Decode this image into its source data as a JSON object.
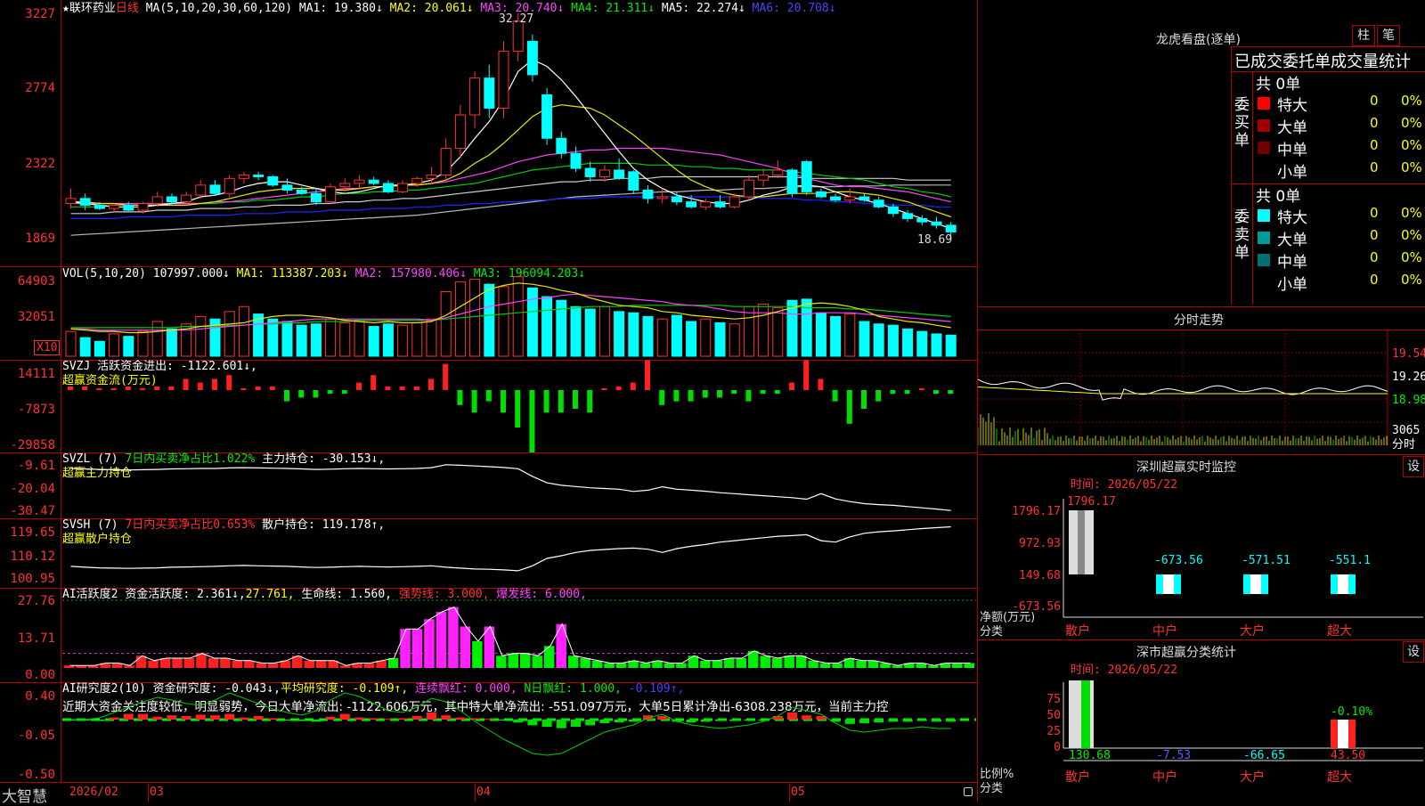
{
  "colors": {
    "up": "#ff3232",
    "down": "#00ffff",
    "ma1": "#ffffff",
    "ma2": "#e8e800",
    "ma3": "#ff44ff",
    "ma4": "#00cc00",
    "ma5": "#cccccc",
    "ma6": "#2222ff",
    "grid": "#b00000"
  },
  "kline": {
    "star": "★",
    "name": "联环药业",
    "period": "日线",
    "ma_label": "MA(5,10,20,30,60,120)",
    "ma1": "MA1: 19.380↓",
    "ma2": "MA2: 20.061↓",
    "ma3": "MA3: 20.740↓",
    "ma4": "MA4: 21.311↓",
    "ma5": "MA5: 22.274↓",
    "ma6": "MA6: 20.708↓",
    "y_ticks": [
      "3227",
      "2774",
      "2322",
      "1869"
    ],
    "high_label": "32.27",
    "low_label": "18.69",
    "candles": [
      [
        20.9,
        21.8,
        20.6,
        21.2
      ],
      [
        21.2,
        21.5,
        20.5,
        20.8
      ],
      [
        20.8,
        21.0,
        20.5,
        20.6
      ],
      [
        20.6,
        20.9,
        20.4,
        20.8
      ],
      [
        20.8,
        21.0,
        20.4,
        20.5
      ],
      [
        20.5,
        21.0,
        20.3,
        20.9
      ],
      [
        20.9,
        21.6,
        20.7,
        21.3
      ],
      [
        21.3,
        21.5,
        20.9,
        21.0
      ],
      [
        21.0,
        21.6,
        20.8,
        21.4
      ],
      [
        21.4,
        22.3,
        21.2,
        22.0
      ],
      [
        22.0,
        22.3,
        21.4,
        21.5
      ],
      [
        21.5,
        22.6,
        21.3,
        22.4
      ],
      [
        22.4,
        22.8,
        22.1,
        22.6
      ],
      [
        22.6,
        22.8,
        22.3,
        22.5
      ],
      [
        22.5,
        22.6,
        21.9,
        22.0
      ],
      [
        22.0,
        22.4,
        21.5,
        21.7
      ],
      [
        21.7,
        21.9,
        21.4,
        21.5
      ],
      [
        21.5,
        21.8,
        20.8,
        21.0
      ],
      [
        21.0,
        22.1,
        20.9,
        21.9
      ],
      [
        21.9,
        22.4,
        21.6,
        22.1
      ],
      [
        22.1,
        22.6,
        21.8,
        22.3
      ],
      [
        22.3,
        22.5,
        22.0,
        22.1
      ],
      [
        22.1,
        22.3,
        21.5,
        21.6
      ],
      [
        21.6,
        22.3,
        21.5,
        22.1
      ],
      [
        22.1,
        22.5,
        21.9,
        22.4
      ],
      [
        22.4,
        23.1,
        22.1,
        22.6
      ],
      [
        22.6,
        24.8,
        22.3,
        24.2
      ],
      [
        24.2,
        26.8,
        23.6,
        26.2
      ],
      [
        26.2,
        28.8,
        25.4,
        28.4
      ],
      [
        28.4,
        29.2,
        26.0,
        26.6
      ],
      [
        26.6,
        30.6,
        26.0,
        30.0
      ],
      [
        30.0,
        32.27,
        29.4,
        31.8
      ],
      [
        30.6,
        31.0,
        28.2,
        28.6
      ],
      [
        27.4,
        27.8,
        24.4,
        24.8
      ],
      [
        24.8,
        25.2,
        23.6,
        23.9
      ],
      [
        23.9,
        24.3,
        22.8,
        23.0
      ],
      [
        23.0,
        23.4,
        22.2,
        22.5
      ],
      [
        22.5,
        23.2,
        22.2,
        22.9
      ],
      [
        22.9,
        23.6,
        22.3,
        22.4
      ],
      [
        22.8,
        22.9,
        21.5,
        21.7
      ],
      [
        21.7,
        22.0,
        20.9,
        21.2
      ],
      [
        21.2,
        21.8,
        20.9,
        21.3
      ],
      [
        21.3,
        21.6,
        20.8,
        21.0
      ],
      [
        21.0,
        21.4,
        20.6,
        20.7
      ],
      [
        20.7,
        21.2,
        20.5,
        21.0
      ],
      [
        21.0,
        21.4,
        20.6,
        20.7
      ],
      [
        20.7,
        21.5,
        20.6,
        21.3
      ],
      [
        21.3,
        22.6,
        21.1,
        22.3
      ],
      [
        22.3,
        23.0,
        21.9,
        22.6
      ],
      [
        22.6,
        23.5,
        22.4,
        22.9
      ],
      [
        22.9,
        23.0,
        21.3,
        21.5
      ],
      [
        23.4,
        23.5,
        21.4,
        21.6
      ],
      [
        21.6,
        21.8,
        21.2,
        21.3
      ],
      [
        21.3,
        21.5,
        21.0,
        21.1
      ],
      [
        21.1,
        21.8,
        20.9,
        21.3
      ],
      [
        21.3,
        21.5,
        21.0,
        21.1
      ],
      [
        21.1,
        21.3,
        20.6,
        20.7
      ],
      [
        20.7,
        20.9,
        20.1,
        20.3
      ],
      [
        20.3,
        20.5,
        19.8,
        20.0
      ],
      [
        20.0,
        20.2,
        19.6,
        19.8
      ],
      [
        19.8,
        20.1,
        19.4,
        19.6
      ],
      [
        19.6,
        19.8,
        18.69,
        19.2
      ]
    ],
    "ma1_line": [
      21.0,
      20.9,
      20.8,
      20.7,
      20.7,
      20.7,
      20.8,
      20.9,
      21.0,
      21.3,
      21.4,
      21.6,
      21.9,
      22.1,
      22.2,
      22.2,
      22.0,
      21.8,
      21.6,
      21.5,
      21.6,
      21.8,
      22.0,
      22.0,
      22.1,
      22.3,
      22.8,
      23.7,
      24.8,
      25.8,
      27.1,
      28.8,
      29.5,
      29.1,
      28.3,
      27.3,
      26.2,
      25.1,
      24.0,
      23.0,
      22.3,
      21.8,
      21.4,
      21.2,
      21.0,
      20.9,
      20.9,
      21.1,
      21.4,
      21.6,
      21.9,
      22.0,
      21.9,
      21.6,
      21.3,
      21.1,
      20.9,
      20.6,
      20.3,
      20.0,
      19.7,
      19.4
    ],
    "ma2_line": [
      21.0,
      21.0,
      20.9,
      20.9,
      20.8,
      20.8,
      20.8,
      20.8,
      20.8,
      20.9,
      21.0,
      21.2,
      21.4,
      21.6,
      21.7,
      21.8,
      21.8,
      21.8,
      21.7,
      21.7,
      21.8,
      21.9,
      21.9,
      22.0,
      22.0,
      22.1,
      22.3,
      22.7,
      23.3,
      23.8,
      24.5,
      25.3,
      26.1,
      26.6,
      26.8,
      26.7,
      26.6,
      26.2,
      25.6,
      25.0,
      24.3,
      23.6,
      22.9,
      22.3,
      21.9,
      21.6,
      21.4,
      21.3,
      21.3,
      21.4,
      21.5,
      21.5,
      21.5,
      21.6,
      21.6,
      21.5,
      21.4,
      21.2,
      21.0,
      20.7,
      20.4,
      20.1
    ],
    "ma3_line": [
      20.9,
      20.9,
      20.9,
      20.9,
      20.9,
      20.9,
      20.9,
      20.9,
      20.9,
      20.9,
      21.0,
      21.0,
      21.1,
      21.2,
      21.3,
      21.4,
      21.5,
      21.6,
      21.7,
      21.8,
      21.8,
      21.9,
      21.9,
      22.0,
      22.0,
      22.1,
      22.2,
      22.4,
      22.6,
      22.8,
      23.1,
      23.4,
      23.6,
      23.8,
      23.9,
      24.0,
      24.1,
      24.1,
      24.2,
      24.2,
      24.2,
      24.2,
      24.1,
      24.0,
      23.9,
      23.8,
      23.6,
      23.4,
      23.2,
      23.0,
      22.7,
      22.4,
      22.2,
      22.0,
      21.9,
      21.9,
      21.8,
      21.7,
      21.6,
      21.4,
      21.2,
      21.0
    ],
    "ma4_line": [
      20.7,
      20.7,
      20.7,
      20.8,
      20.8,
      20.8,
      20.8,
      20.9,
      20.9,
      20.9,
      20.9,
      21.0,
      21.0,
      21.1,
      21.1,
      21.2,
      21.3,
      21.3,
      21.4,
      21.5,
      21.5,
      21.6,
      21.6,
      21.7,
      21.7,
      21.8,
      21.9,
      22.0,
      22.1,
      22.3,
      22.5,
      22.7,
      22.9,
      23.0,
      23.1,
      23.2,
      23.3,
      23.3,
      23.3,
      23.3,
      23.2,
      23.2,
      23.2,
      23.1,
      23.1,
      23.0,
      23.0,
      22.9,
      22.9,
      22.9,
      22.8,
      22.7,
      22.6,
      22.5,
      22.4,
      22.3,
      22.1,
      21.9,
      21.8,
      21.6,
      21.5,
      21.3
    ],
    "ma5_line": [
      20.3,
      20.3,
      20.3,
      20.4,
      20.4,
      20.4,
      20.5,
      20.5,
      20.5,
      20.6,
      20.6,
      20.6,
      20.7,
      20.7,
      20.8,
      20.8,
      20.8,
      20.9,
      20.9,
      21.0,
      21.0,
      21.1,
      21.1,
      21.2,
      21.2,
      21.3,
      21.4,
      21.5,
      21.6,
      21.7,
      21.8,
      21.9,
      22.0,
      22.1,
      22.2,
      22.2,
      22.3,
      22.3,
      22.4,
      22.4,
      22.4,
      22.5,
      22.5,
      22.5,
      22.5,
      22.5,
      22.5,
      22.5,
      22.5,
      22.5,
      22.5,
      22.4,
      22.4,
      22.4,
      22.4,
      22.4,
      22.4,
      22.4,
      22.3,
      22.3,
      22.3,
      22.3
    ],
    "ma6_line": [
      20.0,
      20.0,
      20.0,
      20.0,
      20.1,
      20.1,
      20.1,
      20.1,
      20.2,
      20.2,
      20.2,
      20.2,
      20.3,
      20.3,
      20.3,
      20.4,
      20.4,
      20.4,
      20.5,
      20.5,
      20.5,
      20.6,
      20.6,
      20.6,
      20.7,
      20.7,
      20.8,
      20.8,
      20.9,
      20.9,
      21.0,
      21.0,
      21.1,
      21.1,
      21.2,
      21.2,
      21.2,
      21.3,
      21.3,
      21.3,
      21.3,
      21.3,
      21.3,
      21.3,
      21.3,
      21.3,
      21.3,
      21.3,
      21.2,
      21.2,
      21.2,
      21.1,
      21.1,
      21.0,
      21.0,
      20.9,
      20.9,
      20.8,
      20.8,
      20.8,
      20.7,
      20.7
    ],
    "base_line": [
      19.0,
      19.05,
      19.1,
      19.15,
      19.2,
      19.25,
      19.3,
      19.35,
      19.4,
      19.45,
      19.5,
      19.55,
      19.6,
      19.65,
      19.7,
      19.75,
      19.8,
      19.85,
      19.9,
      19.95,
      20.0,
      20.05,
      20.1,
      20.15,
      20.2,
      20.3,
      20.4,
      20.5,
      20.6,
      20.7,
      20.8,
      20.9,
      21.0,
      21.1,
      21.2,
      21.3,
      21.35,
      21.4,
      21.45,
      21.5,
      21.55,
      21.6,
      21.6,
      21.65,
      21.7,
      21.7,
      21.75,
      21.8,
      21.8,
      21.85,
      21.9,
      21.9,
      21.9,
      21.9,
      21.95,
      21.95,
      21.95,
      22.0,
      22.0,
      22.0,
      22.0,
      22.0
    ]
  },
  "vol": {
    "label": "VOL(5,10,20)",
    "v": "107997.000↓",
    "ma1": "MA1: 113387.203↓",
    "ma2": "MA2: 157980.406↓",
    "ma3": "MA3: 196094.203↓",
    "y_ticks": [
      "64903",
      "32051"
    ],
    "unit": "X10",
    "values": [
      20,
      15,
      12,
      18,
      16,
      20,
      28,
      22,
      26,
      32,
      30,
      36,
      40,
      34,
      30,
      28,
      25,
      26,
      30,
      27,
      29,
      24,
      26,
      25,
      27,
      30,
      52,
      60,
      62,
      58,
      56,
      64,
      55,
      48,
      45,
      40,
      38,
      40,
      36,
      35,
      32,
      30,
      33,
      28,
      30,
      27,
      26,
      40,
      42,
      39,
      45,
      46,
      35,
      32,
      34,
      28,
      26,
      25,
      22,
      20,
      18,
      17
    ],
    "ma1_line": [
      22,
      21,
      20,
      20,
      19,
      19,
      20,
      21,
      22,
      24,
      25,
      26,
      27,
      30,
      32,
      33,
      33,
      32,
      31,
      29,
      28,
      27,
      28,
      27,
      27,
      28,
      33,
      40,
      47,
      54,
      57,
      59,
      58,
      56,
      53,
      51,
      47,
      44,
      41,
      40,
      39,
      36,
      35,
      33,
      32,
      31,
      30,
      31,
      33,
      36,
      39,
      42,
      43,
      42,
      40,
      37,
      32,
      30,
      28,
      27,
      25,
      23
    ],
    "ma2_line": [
      22,
      22,
      21,
      21,
      21,
      21,
      21,
      21,
      21,
      22,
      23,
      24,
      25,
      26,
      27,
      28,
      29,
      30,
      30,
      30,
      30,
      30,
      30,
      30,
      30,
      29,
      31,
      34,
      37,
      40,
      42,
      44,
      46,
      47,
      49,
      50,
      49,
      48,
      47,
      46,
      45,
      44,
      42,
      41,
      40,
      38,
      36,
      35,
      35,
      35,
      34,
      34,
      35,
      35,
      35,
      34,
      33,
      32,
      31,
      30,
      29,
      28
    ],
    "ma3_line": [
      23,
      23,
      23,
      23,
      23,
      23,
      23,
      23,
      24,
      24,
      24,
      25,
      25,
      26,
      26,
      27,
      27,
      28,
      28,
      28,
      29,
      29,
      29,
      29,
      29,
      29,
      30,
      31,
      32,
      33,
      34,
      35,
      36,
      37,
      38,
      39,
      40,
      40,
      40,
      41,
      41,
      41,
      41,
      41,
      41,
      41,
      40,
      40,
      40,
      40,
      40,
      39,
      39,
      39,
      38,
      38,
      37,
      36,
      35,
      34,
      33,
      32
    ]
  },
  "svzj": {
    "label": "SVZJ",
    "active": "活跃资金进出: -1122.601↓,",
    "sub": "超赢资金流(万元)",
    "y_ticks": [
      "14111",
      "-7873",
      "-29858"
    ],
    "values": [
      1,
      1,
      0.5,
      0.5,
      1,
      0.5,
      1,
      1,
      3,
      2,
      3,
      4,
      0.5,
      1,
      1,
      -3,
      -2,
      -2,
      -1,
      -1,
      2,
      4,
      1,
      1,
      1,
      3,
      7,
      -4,
      -6,
      -3,
      -6,
      -10,
      -19,
      -6,
      -6,
      -5,
      -6,
      0.5,
      1,
      2,
      8,
      -4,
      -3,
      -3,
      -2,
      -2,
      -1,
      -3,
      -1,
      -1,
      2,
      8,
      3,
      -3,
      -9,
      -5,
      -3,
      -1,
      -1,
      0.5,
      -1,
      -1
    ]
  },
  "svzl": {
    "label": "SVZL (7)",
    "ratio": "7日内买卖净占比1.022%",
    "hold": "主力持仓: -30.153↓,",
    "sub": "超赢主力持仓",
    "y_ticks": [
      "-9.61",
      "-20.04",
      "-30.47"
    ],
    "line": [
      -13.2,
      -13.4,
      -13.6,
      -13.7,
      -13.8,
      -13.7,
      -13.6,
      -13.4,
      -13.3,
      -13.2,
      -13.2,
      -13.0,
      -12.9,
      -13.0,
      -13.1,
      -13.2,
      -13.4,
      -13.6,
      -13.5,
      -13.3,
      -13.2,
      -13.3,
      -13.4,
      -13.3,
      -13.2,
      -12.9,
      -11.7,
      -11.9,
      -12.2,
      -12.5,
      -12.8,
      -13.3,
      -16.4,
      -19.0,
      -20.0,
      -20.5,
      -21.0,
      -21.3,
      -21.6,
      -22.5,
      -22.0,
      -20.6,
      -21.6,
      -22.0,
      -22.4,
      -23.0,
      -23.4,
      -23.8,
      -24.2,
      -24.6,
      -25.0,
      -25.6,
      -23.4,
      -25.5,
      -26.6,
      -27.4,
      -27.8,
      -28.1,
      -28.6,
      -29.1,
      -29.6,
      -30.2
    ]
  },
  "svsh": {
    "label": "SVSH (7)",
    "ratio": "7日内买卖净占比0.653%",
    "hold": "散户持仓: 119.178↑,",
    "sub": "超赢散户持仓",
    "y_ticks": [
      "119.65",
      "110.12",
      "100.95"
    ],
    "line": [
      105.8,
      105.5,
      105.3,
      105.2,
      105.1,
      105.2,
      105.3,
      105.5,
      105.6,
      105.7,
      105.8,
      106.0,
      106.1,
      106.0,
      105.9,
      105.8,
      105.6,
      105.4,
      105.5,
      105.7,
      105.8,
      105.7,
      105.6,
      105.7,
      105.8,
      106.0,
      105.5,
      105.2,
      104.9,
      104.8,
      104.6,
      104.3,
      106.0,
      108.5,
      109.4,
      110.5,
      111.2,
      111.5,
      111.8,
      112.0,
      111.6,
      110.5,
      111.8,
      112.6,
      113.2,
      114.0,
      114.5,
      115.0,
      115.5,
      116.0,
      116.2,
      116.5,
      114.5,
      114.0,
      115.8,
      117.0,
      117.5,
      117.8,
      118.2,
      118.6,
      118.9,
      119.2
    ]
  },
  "ai1": {
    "label": "AI活跃度2",
    "activity": "资金活跃度: 2.361↓,",
    "v2": "27.761,",
    "life": "生命线: 1.560,",
    "strong": "强势线: 3.000,",
    "burst": "爆发线: 6.000,",
    "y_ticks": [
      "27.76",
      "13.71",
      "0.00"
    ],
    "values": [
      1,
      1,
      1,
      2,
      2,
      1,
      5,
      3,
      4,
      4,
      4,
      6,
      4,
      4,
      3,
      3,
      2,
      2,
      3,
      5,
      3,
      3,
      3,
      1,
      2,
      2,
      3,
      4,
      16,
      16,
      20,
      23,
      25,
      17,
      11,
      17,
      5,
      6,
      6,
      5,
      9,
      18,
      5,
      4,
      3,
      2,
      2,
      3,
      2,
      3,
      2,
      2,
      5,
      3,
      3,
      4,
      4,
      7,
      5,
      4,
      5,
      5,
      3,
      2,
      2,
      4,
      3,
      3,
      2,
      1,
      2,
      2,
      1,
      2,
      2,
      2
    ]
  },
  "ai2": {
    "label": "AI研究度2(10)",
    "research": "资金研究度: -0.043↓,",
    "avg": "平均研究度: -0.109↑,",
    "streak": "连续飘红: 0.000,",
    "n_red": "N日飘红: 1.000,",
    "v": "-0.109↑,",
    "y_ticks": [
      "0.40",
      "-0.05",
      "-0.50"
    ],
    "comment": "近期大资金关注度较低，明显弱势，今日大单净流出: -1122.606万元，其中特大单净流出: -551.097万元，大单5日累计净出-6308.238万元，当前主力控"
  },
  "bottom": {
    "logo": "大智慧",
    "dates": [
      "2026/02",
      "03",
      "04",
      "05"
    ]
  },
  "dragon": {
    "title": "龙虎看盘(逐单)",
    "btn1": "柱",
    "btn2": "笔",
    "tabs_label": "已成交委托单成交量统计",
    "buy_label": "委买单",
    "sell_label": "委卖单",
    "total_buy": "共 0单",
    "total_sell": "共 0单",
    "buy_rows": [
      {
        "label": "特大",
        "count": "0",
        "pct": "0%",
        "color": "#ff0000"
      },
      {
        "label": "大单",
        "count": "0",
        "pct": "0%",
        "color": "#a00000"
      },
      {
        "label": "中单",
        "count": "0",
        "pct": "0%",
        "color": "#700000"
      },
      {
        "label": "小单",
        "count": "0",
        "pct": "0%",
        "color": "#000000"
      }
    ],
    "sell_rows": [
      {
        "label": "特大",
        "count": "0",
        "pct": "0%",
        "color": "#00ffff"
      },
      {
        "label": "大单",
        "count": "0",
        "pct": "0%",
        "color": "#009a9a"
      },
      {
        "label": "中单",
        "count": "0",
        "pct": "0%",
        "color": "#007070"
      },
      {
        "label": "小单",
        "count": "0",
        "pct": "0%",
        "color": "#000000"
      }
    ]
  },
  "intraday": {
    "title": "分时走势",
    "p_hi": "19.54",
    "p_mid": "19.26",
    "p_lo": "18.98",
    "vol_label": "3065",
    "sub": "分时"
  },
  "monitor": {
    "title": "深圳超赢实时监控",
    "set": "设",
    "time": "时间: 2026/05/22",
    "y_ticks": [
      "1796.17",
      "972.93",
      "149.68",
      "-673.56"
    ],
    "bar_labels": [
      "1796.17",
      "-673.56",
      "-571.51",
      "-551.1"
    ],
    "xcats": [
      "散户",
      "中户",
      "大户",
      "超大"
    ],
    "ylabel1": "净额(万元)",
    "ylabel2": "分类"
  },
  "classify": {
    "title": "深市超赢分类统计",
    "set": "设",
    "time": "时间: 2026/05/22",
    "y_ticks": [
      "75",
      "50",
      "25",
      "0"
    ],
    "top_label": "-0.10%",
    "values": [
      "130.68",
      "-7.53",
      "-66.65",
      "43.50"
    ],
    "xcats": [
      "散户",
      "中户",
      "大户",
      "超大"
    ],
    "ylabel1": "比例%",
    "ylabel2": "分类"
  }
}
